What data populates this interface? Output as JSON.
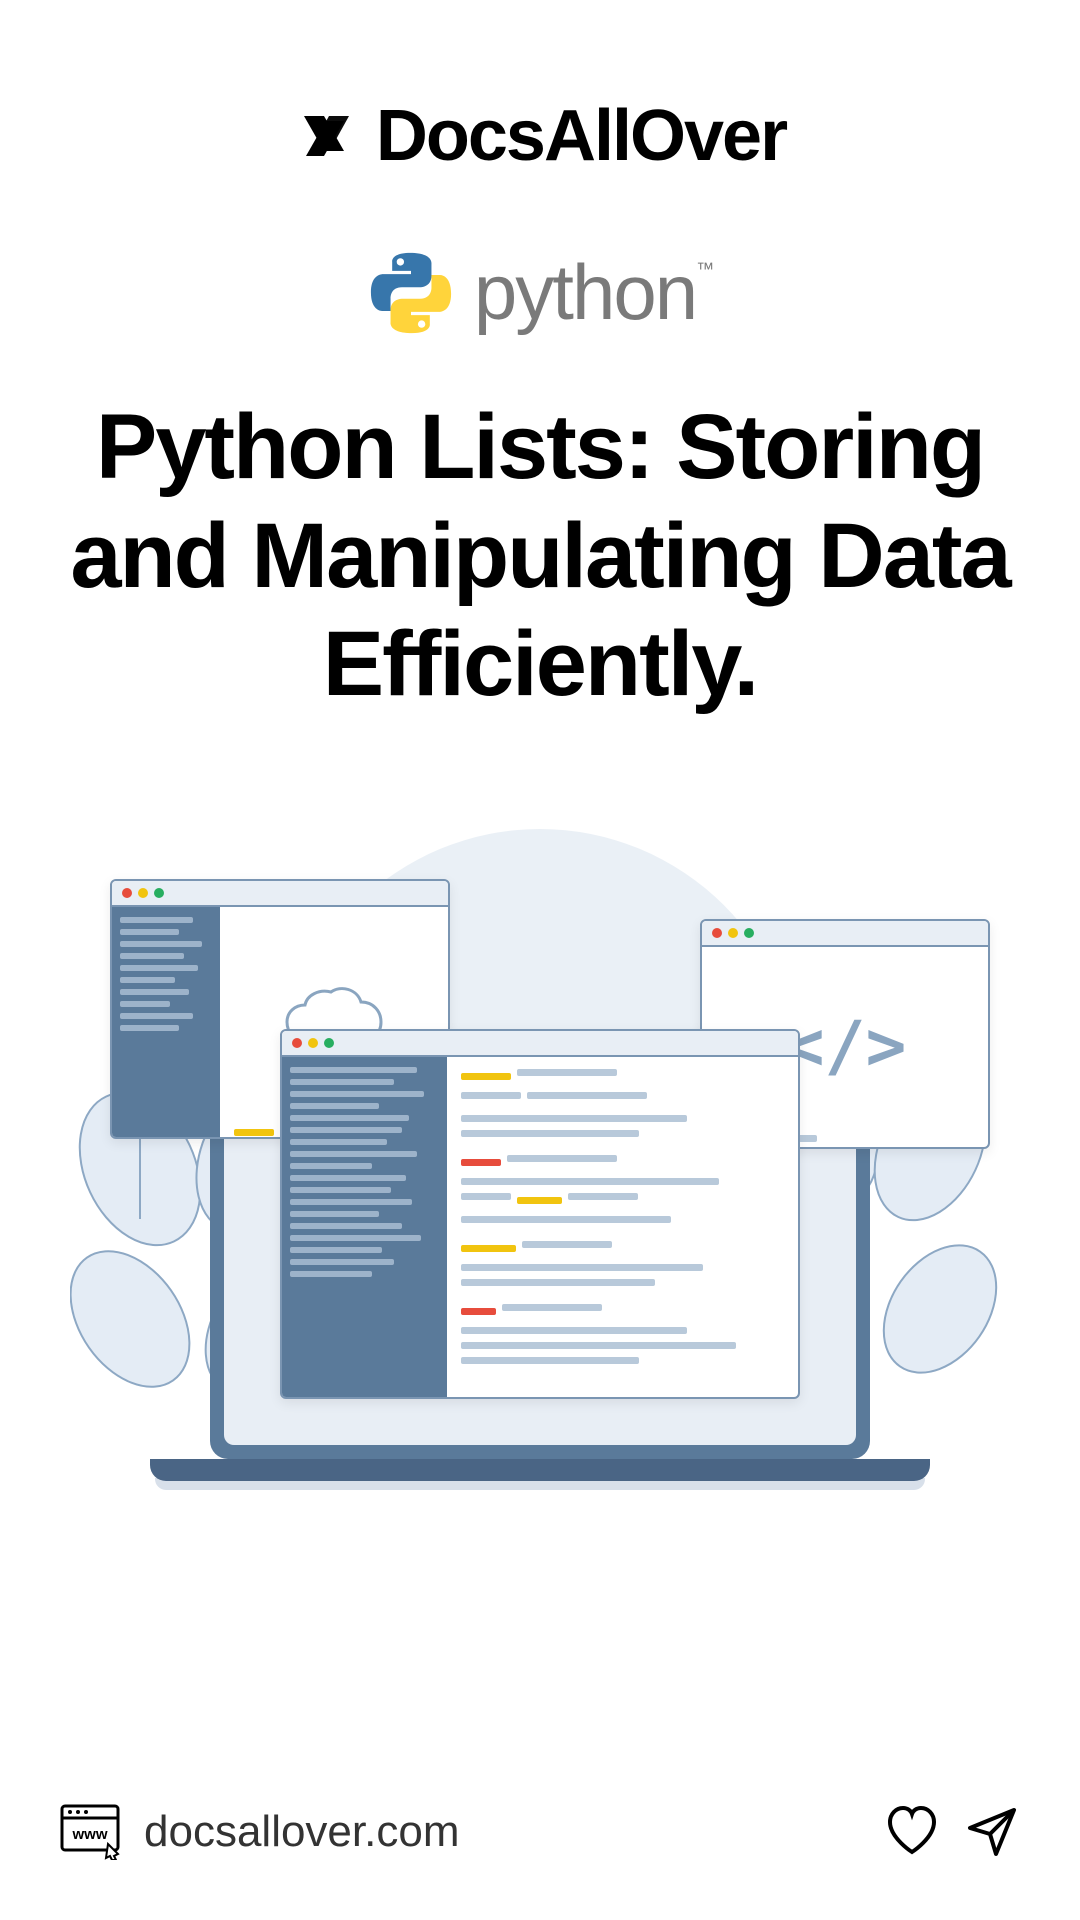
{
  "brand": {
    "name": "DocsAllOver"
  },
  "tech": {
    "name": "python",
    "trademark": "™"
  },
  "title": "Python Lists: Storing and Manipulating Data Efficiently.",
  "footer": {
    "url": "docsallover.com",
    "website_label": "www"
  },
  "illustration": {
    "code_symbol": "</>"
  }
}
